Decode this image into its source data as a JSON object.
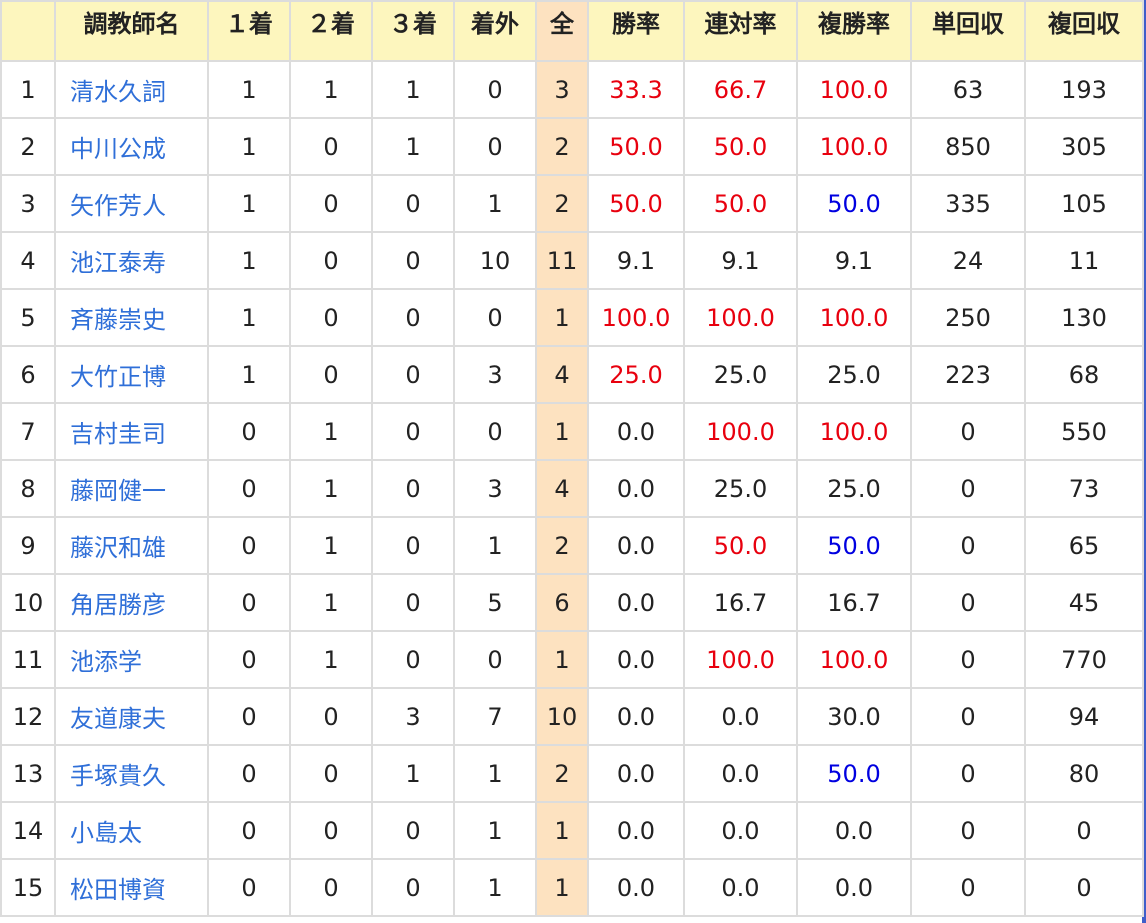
{
  "colors": {
    "header_bg": "#fdf6be",
    "total_column_bg": "#fde2c0",
    "name_link": "#2f6fd8",
    "rate_red": "#e8000e",
    "rate_blue": "#0000e0",
    "grid": "#dcdcdc"
  },
  "headers": {
    "rank": "",
    "name": "調教師名",
    "first": "１着",
    "second": "２着",
    "third": "３着",
    "out": "着外",
    "total": "全",
    "win_rate": "勝率",
    "quinella_rate": "連対率",
    "show_rate": "複勝率",
    "win_return": "単回収",
    "show_return": "複回収"
  },
  "rows": [
    {
      "rank": "1",
      "name": "清水久詞",
      "first": "1",
      "second": "1",
      "third": "1",
      "out": "0",
      "total": "3",
      "win_rate": "33.3",
      "quinella_rate": "66.7",
      "show_rate": "100.0",
      "win_return": "63",
      "show_return": "193"
    },
    {
      "rank": "2",
      "name": "中川公成",
      "first": "1",
      "second": "0",
      "third": "1",
      "out": "0",
      "total": "2",
      "win_rate": "50.0",
      "quinella_rate": "50.0",
      "show_rate": "100.0",
      "win_return": "850",
      "show_return": "305"
    },
    {
      "rank": "3",
      "name": "矢作芳人",
      "first": "1",
      "second": "0",
      "third": "0",
      "out": "1",
      "total": "2",
      "win_rate": "50.0",
      "quinella_rate": "50.0",
      "show_rate": "50.0",
      "win_return": "335",
      "show_return": "105"
    },
    {
      "rank": "4",
      "name": "池江泰寿",
      "first": "1",
      "second": "0",
      "third": "0",
      "out": "10",
      "total": "11",
      "win_rate": "9.1",
      "quinella_rate": "9.1",
      "show_rate": "9.1",
      "win_return": "24",
      "show_return": "11"
    },
    {
      "rank": "5",
      "name": "斉藤崇史",
      "first": "1",
      "second": "0",
      "third": "0",
      "out": "0",
      "total": "1",
      "win_rate": "100.0",
      "quinella_rate": "100.0",
      "show_rate": "100.0",
      "win_return": "250",
      "show_return": "130"
    },
    {
      "rank": "6",
      "name": "大竹正博",
      "first": "1",
      "second": "0",
      "third": "0",
      "out": "3",
      "total": "4",
      "win_rate": "25.0",
      "quinella_rate": "25.0",
      "show_rate": "25.0",
      "win_return": "223",
      "show_return": "68"
    },
    {
      "rank": "7",
      "name": "吉村圭司",
      "first": "0",
      "second": "1",
      "third": "0",
      "out": "0",
      "total": "1",
      "win_rate": "0.0",
      "quinella_rate": "100.0",
      "show_rate": "100.0",
      "win_return": "0",
      "show_return": "550"
    },
    {
      "rank": "8",
      "name": "藤岡健一",
      "first": "0",
      "second": "1",
      "third": "0",
      "out": "3",
      "total": "4",
      "win_rate": "0.0",
      "quinella_rate": "25.0",
      "show_rate": "25.0",
      "win_return": "0",
      "show_return": "73"
    },
    {
      "rank": "9",
      "name": "藤沢和雄",
      "first": "0",
      "second": "1",
      "third": "0",
      "out": "1",
      "total": "2",
      "win_rate": "0.0",
      "quinella_rate": "50.0",
      "show_rate": "50.0",
      "win_return": "0",
      "show_return": "65"
    },
    {
      "rank": "10",
      "name": "角居勝彦",
      "first": "0",
      "second": "1",
      "third": "0",
      "out": "5",
      "total": "6",
      "win_rate": "0.0",
      "quinella_rate": "16.7",
      "show_rate": "16.7",
      "win_return": "0",
      "show_return": "45"
    },
    {
      "rank": "11",
      "name": "池添学",
      "first": "0",
      "second": "1",
      "third": "0",
      "out": "0",
      "total": "1",
      "win_rate": "0.0",
      "quinella_rate": "100.0",
      "show_rate": "100.0",
      "win_return": "0",
      "show_return": "770"
    },
    {
      "rank": "12",
      "name": "友道康夫",
      "first": "0",
      "second": "0",
      "third": "3",
      "out": "7",
      "total": "10",
      "win_rate": "0.0",
      "quinella_rate": "0.0",
      "show_rate": "30.0",
      "win_return": "0",
      "show_return": "94"
    },
    {
      "rank": "13",
      "name": "手塚貴久",
      "first": "0",
      "second": "0",
      "third": "1",
      "out": "1",
      "total": "2",
      "win_rate": "0.0",
      "quinella_rate": "0.0",
      "show_rate": "50.0",
      "win_return": "0",
      "show_return": "80"
    },
    {
      "rank": "14",
      "name": "小島太",
      "first": "0",
      "second": "0",
      "third": "0",
      "out": "1",
      "total": "1",
      "win_rate": "0.0",
      "quinella_rate": "0.0",
      "show_rate": "0.0",
      "win_return": "0",
      "show_return": "0"
    },
    {
      "rank": "15",
      "name": "松田博資",
      "first": "0",
      "second": "0",
      "third": "0",
      "out": "1",
      "total": "1",
      "win_rate": "0.0",
      "quinella_rate": "0.0",
      "show_rate": "0.0",
      "win_return": "0",
      "show_return": "0"
    }
  ],
  "highlight": {
    "win_rate": [
      "red",
      "red",
      "red",
      "black",
      "red",
      "red",
      "black",
      "black",
      "black",
      "black",
      "black",
      "black",
      "black",
      "black",
      "black"
    ],
    "quinella_rate": [
      "red",
      "red",
      "red",
      "black",
      "red",
      "black",
      "red",
      "black",
      "red",
      "black",
      "red",
      "black",
      "black",
      "black",
      "black"
    ],
    "show_rate": [
      "red",
      "red",
      "blue",
      "black",
      "red",
      "black",
      "red",
      "black",
      "blue",
      "black",
      "red",
      "black",
      "blue",
      "black",
      "black"
    ]
  }
}
